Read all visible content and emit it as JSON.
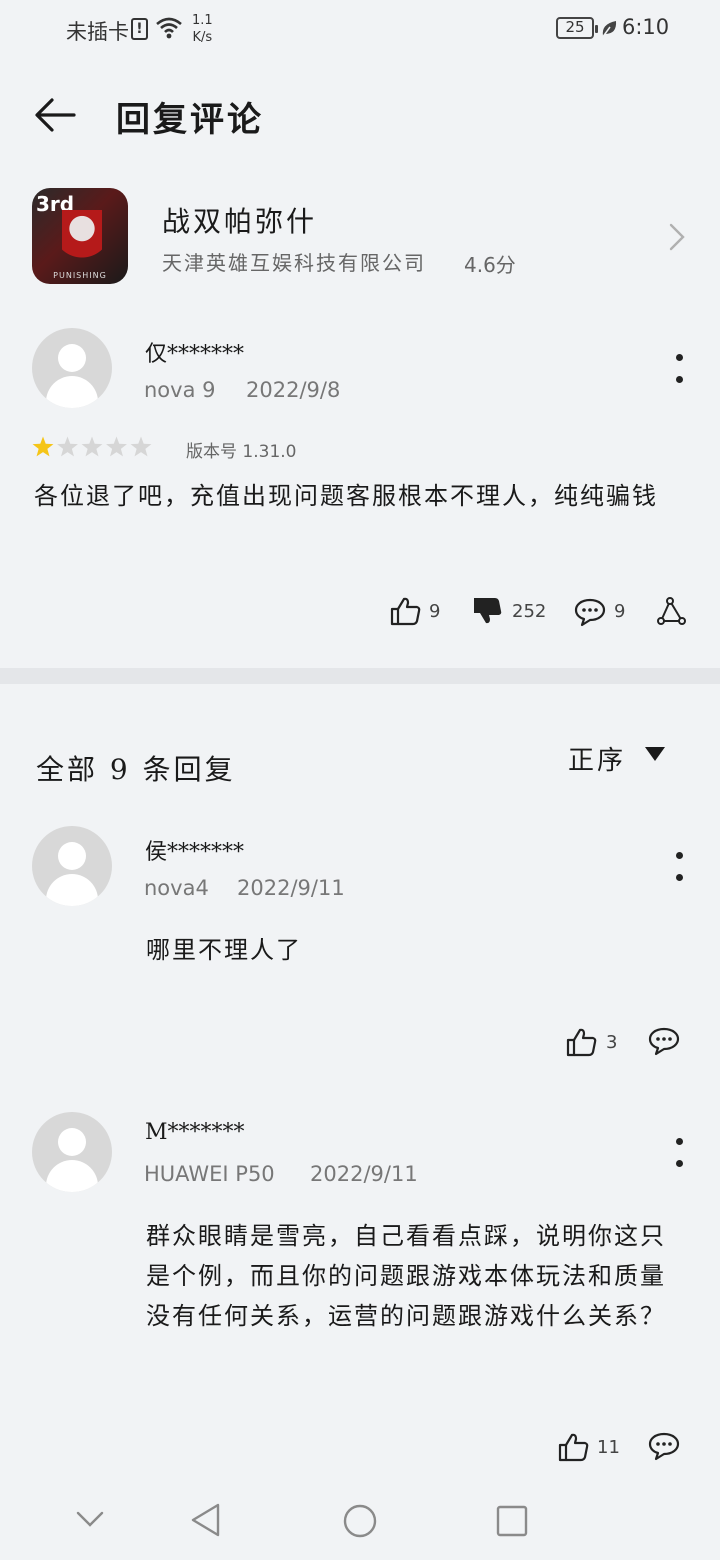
{
  "status_bar": {
    "carrier": "未插卡",
    "sim_mark": "!",
    "net_speed_value": "1.1",
    "net_speed_unit": "K/s",
    "battery": "25",
    "time": "6:10"
  },
  "header": {
    "title": "回复评论"
  },
  "app": {
    "icon_badge": "3rd",
    "icon_sub": "PUNISHING",
    "name": "战双帕弥什",
    "developer": "天津英雄互娱科技有限公司",
    "score": "4.6分"
  },
  "review": {
    "user": "仅*******",
    "device": "nova 9",
    "date": "2022/9/8",
    "rating": 1,
    "rating_max": 5,
    "version_label": "版本号",
    "version": "1.31.0",
    "text": "各位退了吧，充值出现问题客服根本不理人，纯纯骗钱",
    "likes": "9",
    "dislikes": "252",
    "comments": "9"
  },
  "replies_section": {
    "title": "全部 9 条回复",
    "sort": "正序"
  },
  "replies": [
    {
      "user": "侯*******",
      "device": "nova4",
      "date": "2022/9/11",
      "text": "哪里不理人了",
      "likes": "3"
    },
    {
      "user": "M*******",
      "device": "HUAWEI P50",
      "date": "2022/9/11",
      "text": "群众眼睛是雪亮，自己看看点踩，说明你这只是个例，而且你的问题跟游戏本体玩法和质量没有任何关系，运营的问题跟游戏什么关系？",
      "likes": "11"
    }
  ],
  "colors": {
    "background": "#f1f3f5",
    "star_active": "#f5c518",
    "star_inactive": "#d6d6d6",
    "divider": "#e4e6e9"
  }
}
